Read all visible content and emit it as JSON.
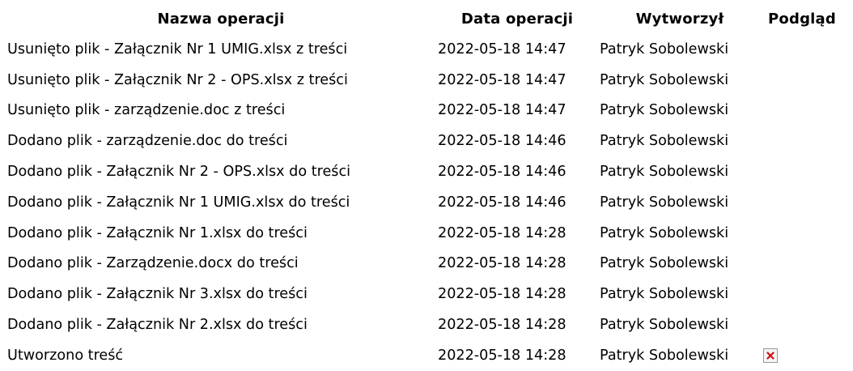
{
  "table": {
    "headers": {
      "name": "Nazwa operacji",
      "date": "Data operacji",
      "user": "Wytworzył",
      "preview": "Podgląd"
    },
    "rows": [
      {
        "name": "Usunięto plik - Załącznik Nr 1 UMIG.xlsx z treści",
        "date": "2022-05-18 14:47",
        "user": "Patryk Sobolewski"
      },
      {
        "name": "Usunięto plik - Załącznik Nr 2 - OPS.xlsx z treści",
        "date": "2022-05-18 14:47",
        "user": "Patryk Sobolewski"
      },
      {
        "name": "Usunięto plik - zarządzenie.doc z treści",
        "date": "2022-05-18 14:47",
        "user": "Patryk Sobolewski"
      },
      {
        "name": "Dodano plik - zarządzenie.doc do treści",
        "date": "2022-05-18 14:46",
        "user": "Patryk Sobolewski"
      },
      {
        "name": "Dodano plik - Załącznik Nr 2 - OPS.xlsx do treści",
        "date": "2022-05-18 14:46",
        "user": "Patryk Sobolewski"
      },
      {
        "name": "Dodano plik - Załącznik Nr 1 UMIG.xlsx do treści",
        "date": "2022-05-18 14:46",
        "user": "Patryk Sobolewski"
      },
      {
        "name": "Dodano plik - Załącznik Nr 1.xlsx do treści",
        "date": "2022-05-18 14:28",
        "user": "Patryk Sobolewski"
      },
      {
        "name": "Dodano plik - Zarządzenie.docx do treści",
        "date": "2022-05-18 14:28",
        "user": "Patryk Sobolewski"
      },
      {
        "name": "Dodano plik - Załącznik Nr 3.xlsx do treści",
        "date": "2022-05-18 14:28",
        "user": "Patryk Sobolewski"
      },
      {
        "name": "Dodano plik - Załącznik Nr 2.xlsx do treści",
        "date": "2022-05-18 14:28",
        "user": "Patryk Sobolewski"
      },
      {
        "name": "Utworzono treść",
        "date": "2022-05-18 14:28",
        "user": "Patryk Sobolewski",
        "preview_icon": "broken-image-icon"
      }
    ]
  },
  "colors": {
    "text": "#000000",
    "icon_border": "#9a9a9a",
    "icon_x": "#d01010"
  }
}
